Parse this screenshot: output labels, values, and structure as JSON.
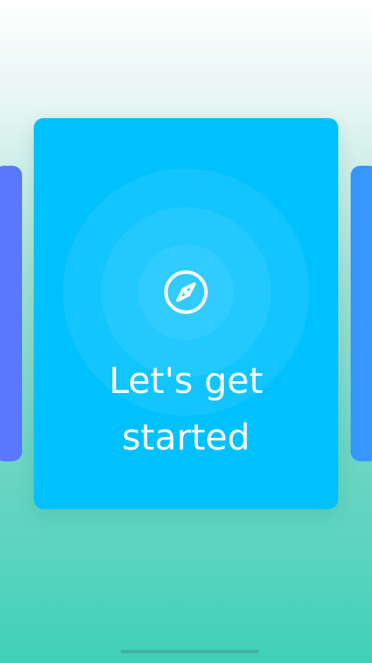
{
  "onboarding": {
    "title_line1": "Let's get",
    "title_line2": "started",
    "icon": "compass-icon"
  },
  "colors": {
    "main_card": "#00c1ff",
    "prev_card": "#5a79ff",
    "next_card": "#3797ff",
    "text": "#ffffff"
  }
}
